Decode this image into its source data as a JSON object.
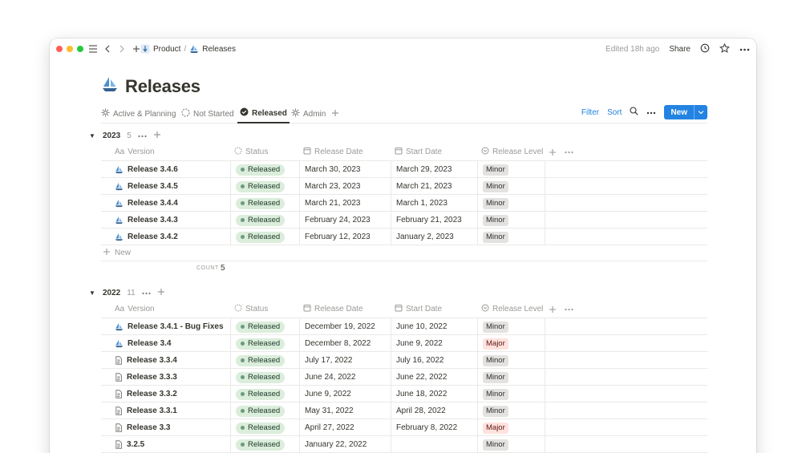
{
  "breadcrumb": {
    "parent": "Product",
    "separator": "/",
    "current": "Releases"
  },
  "topbar": {
    "edited": "Edited 18h ago",
    "share": "Share"
  },
  "page": {
    "title": "Releases"
  },
  "views": [
    {
      "label": "Active & Planning",
      "icon": "gear-icon"
    },
    {
      "label": "Not Started",
      "icon": "dashed-circle-icon"
    },
    {
      "label": "Released",
      "icon": "check-circle-icon",
      "active": true
    },
    {
      "label": "Admin",
      "icon": "gear-icon"
    }
  ],
  "actions": {
    "filter": "Filter",
    "sort": "Sort",
    "new": "New"
  },
  "columns": {
    "version": "Version",
    "version_prefix": "Aa",
    "status": "Status",
    "release_date": "Release Date",
    "start_date": "Start Date",
    "release_level": "Release Level"
  },
  "groups": [
    {
      "name": "2023",
      "count": "5",
      "new_label": "New",
      "count_label": "COUNT",
      "count_value": "5",
      "rows": [
        {
          "version": "Release 3.4.6",
          "icon": "sailboat",
          "status": "Released",
          "release_date": "March 30, 2023",
          "start_date": "March 29, 2023",
          "level": "Minor"
        },
        {
          "version": "Release 3.4.5",
          "icon": "sailboat",
          "status": "Released",
          "release_date": "March 23, 2023",
          "start_date": "March 21, 2023",
          "level": "Minor"
        },
        {
          "version": "Release 3.4.4",
          "icon": "sailboat",
          "status": "Released",
          "release_date": "March 21, 2023",
          "start_date": "March 1, 2023",
          "level": "Minor"
        },
        {
          "version": "Release 3.4.3",
          "icon": "sailboat",
          "status": "Released",
          "release_date": "February 24, 2023",
          "start_date": "February 21, 2023",
          "level": "Minor"
        },
        {
          "version": "Release 3.4.2",
          "icon": "sailboat",
          "status": "Released",
          "release_date": "February 12, 2023",
          "start_date": "January 2, 2023",
          "level": "Minor"
        }
      ]
    },
    {
      "name": "2022",
      "count": "11",
      "rows": [
        {
          "version": "Release 3.4.1 - Bug Fixes",
          "icon": "sailboat",
          "status": "Released",
          "release_date": "December 19, 2022",
          "start_date": "June 10, 2022",
          "level": "Minor"
        },
        {
          "version": "Release 3.4",
          "icon": "sailboat",
          "status": "Released",
          "release_date": "December 8, 2022",
          "start_date": "June 9, 2022",
          "level": "Major"
        },
        {
          "version": "Release 3.3.4",
          "icon": "page",
          "status": "Released",
          "release_date": "July 17, 2022",
          "start_date": "July 16, 2022",
          "level": "Minor"
        },
        {
          "version": "Release 3.3.3",
          "icon": "page",
          "status": "Released",
          "release_date": "June 24, 2022",
          "start_date": "June 22, 2022",
          "level": "Minor"
        },
        {
          "version": "Release 3.3.2",
          "icon": "page",
          "status": "Released",
          "release_date": "June 9, 2022",
          "start_date": "June 18, 2022",
          "level": "Minor"
        },
        {
          "version": "Release 3.3.1",
          "icon": "page",
          "status": "Released",
          "release_date": "May 31, 2022",
          "start_date": "April 28, 2022",
          "level": "Minor"
        },
        {
          "version": "Release 3.3",
          "icon": "page",
          "status": "Released",
          "release_date": "April 27, 2022",
          "start_date": "February 8, 2022",
          "level": "Major"
        },
        {
          "version": "3.2.5",
          "icon": "page",
          "status": "Released",
          "release_date": "January 22, 2022",
          "start_date": "",
          "level": "Minor"
        }
      ]
    }
  ],
  "colors": {
    "accent": "#2383e2",
    "released_bg": "#dbeddb",
    "minor_bg": "#e3e2e0",
    "major_bg": "#ffe2dd"
  }
}
